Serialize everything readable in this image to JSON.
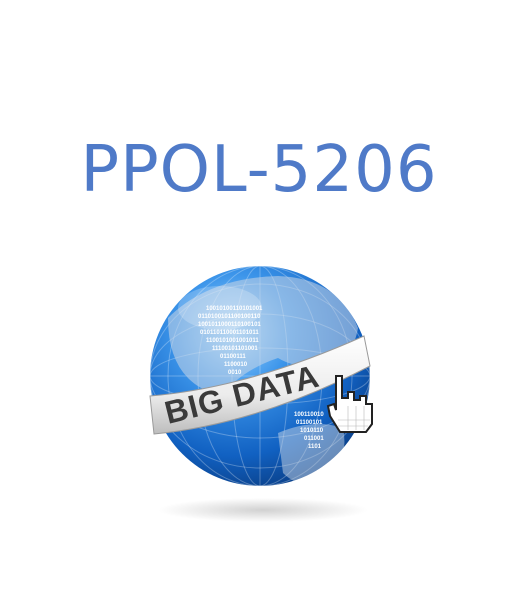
{
  "title": "PPOL-5206",
  "logo": {
    "banner_text": "BIG DATA",
    "binary_rows": [
      "10010100110101001",
      "0110100101100100110",
      "1001011000110100101",
      "010110110001101011",
      "1100101001001011",
      "11100101101001",
      "01100111",
      "1100010",
      "0010"
    ],
    "binary_lower": [
      "100110010",
      "01100101",
      "1010110",
      "011001",
      "1101"
    ]
  },
  "colors": {
    "title": "#4f7ac8",
    "globe_light": "#5ab3ff",
    "globe_dark": "#0b4fa8",
    "banner": "#f2f2f2",
    "banner_text": "#3a3a3a"
  }
}
